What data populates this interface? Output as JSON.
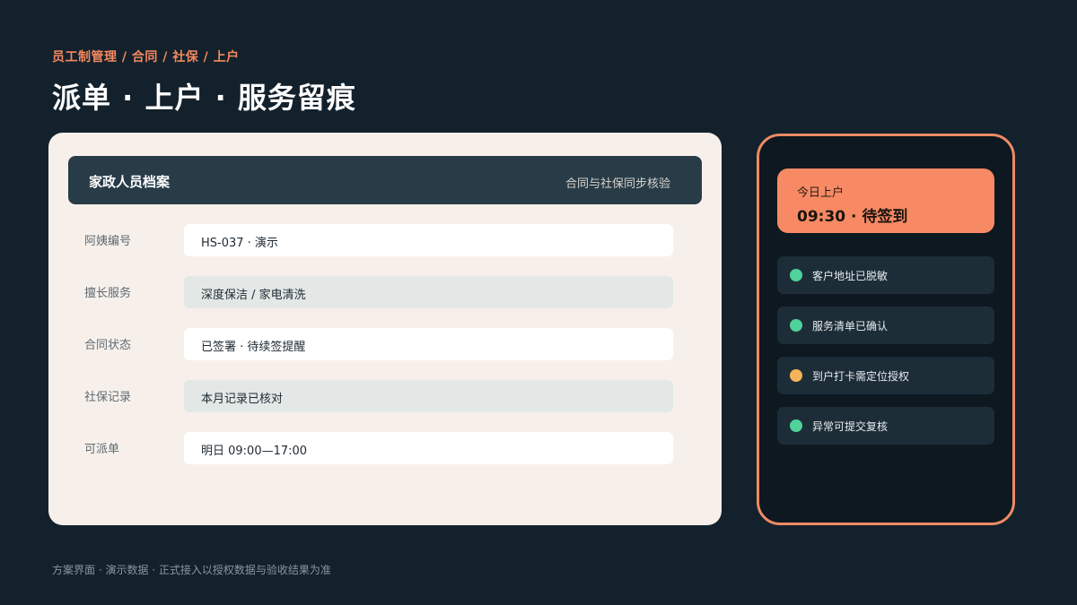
{
  "breadcrumb": "员工制管理 / 合同 / 社保 / 上户",
  "title": "派单 · 上户 · 服务留痕",
  "profile_card": {
    "header_title": "家政人员档案",
    "header_subtitle": "合同与社保同步核验",
    "fields": [
      {
        "label": "阿姨编号",
        "value": "HS-037 · 演示"
      },
      {
        "label": "擅长服务",
        "value": "深度保洁 / 家电清洗"
      },
      {
        "label": "合同状态",
        "value": "已签署 · 待续签提醒"
      },
      {
        "label": "社保记录",
        "value": "本月记录已核对"
      },
      {
        "label": "可派单",
        "value": "明日 09:00—17:00"
      }
    ]
  },
  "phone": {
    "checkin_label": "今日上户",
    "checkin_value": "09:30 · 待签到",
    "status_items": [
      {
        "text": "客户地址已脱敏",
        "status": "ok",
        "color": "#4fd39a"
      },
      {
        "text": "服务清单已确认",
        "status": "ok",
        "color": "#4fd39a"
      },
      {
        "text": "到户打卡需定位授权",
        "status": "warning",
        "color": "#f6b45a"
      },
      {
        "text": "异常可提交复核",
        "status": "ok",
        "color": "#4fd39a"
      }
    ]
  },
  "footer_note": "方案界面 · 演示数据 · 正式接入以授权数据与验收结果为准",
  "colors": {
    "background": "#13212c",
    "accent": "#f78a64",
    "ok": "#4fd39a",
    "warning": "#f6b45a"
  }
}
